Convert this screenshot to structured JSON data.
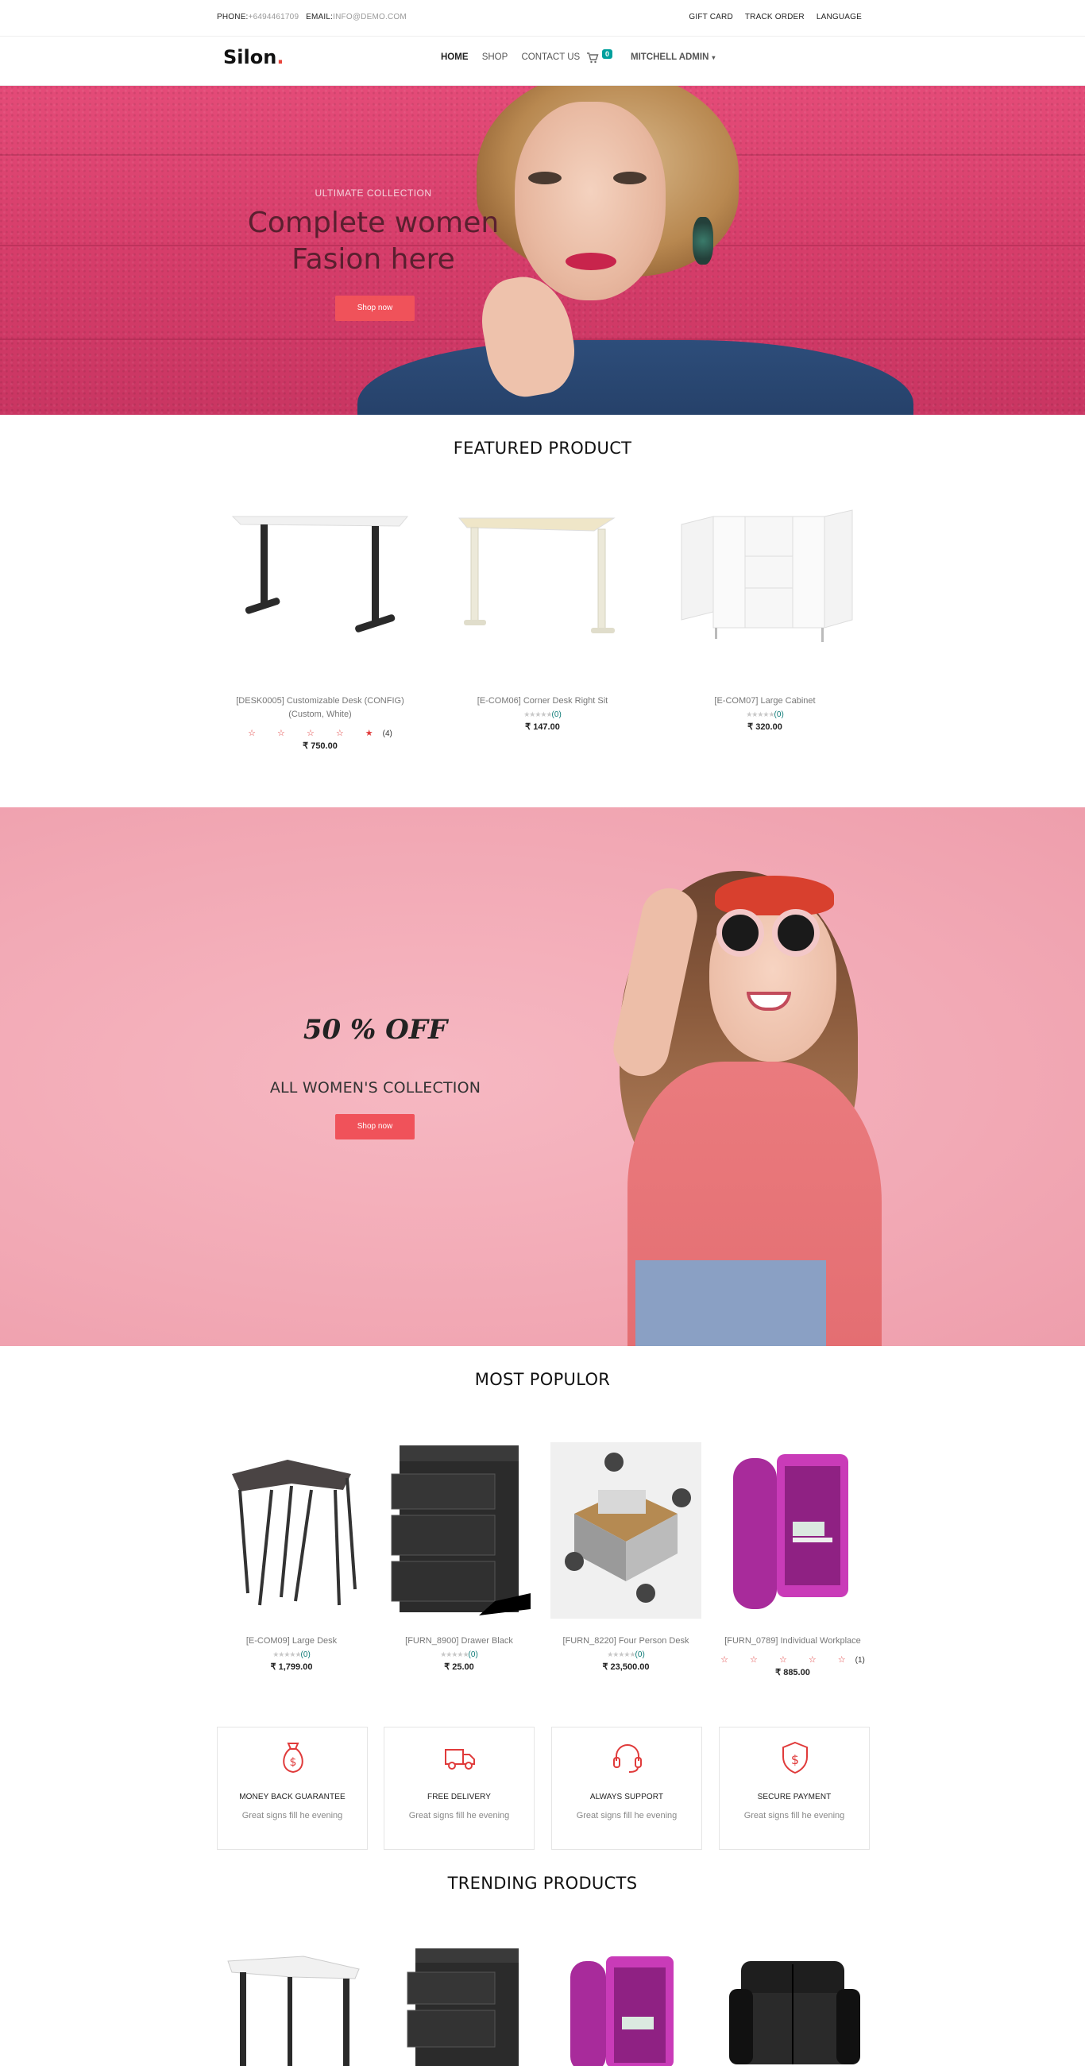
{
  "topbar": {
    "phone_label": "PHONE:",
    "phone_value": "+6494461709",
    "email_label": "EMAIL:",
    "email_value": "INFO@DEMO.COM",
    "links": [
      "GIFT CARD",
      "TRACK ORDER",
      "LANGUAGE"
    ]
  },
  "nav": {
    "logo": "Silon",
    "logo_dot": ".",
    "menu": [
      "HOME",
      "SHOP",
      "CONTACT US"
    ],
    "cart_count": "0",
    "user": "MITCHELL ADMIN",
    "caret": "▾"
  },
  "hero": {
    "subtitle": "ULTIMATE COLLECTION",
    "title": "Complete women Fasion here",
    "button": "Shop now",
    "bg_color": "#d9416e"
  },
  "featured": {
    "title": "FEATURED PRODUCT",
    "products": [
      {
        "name": "[DESK0005] Customizable Desk (CONFIG) (Custom, White)",
        "stars": "☆ ☆ ☆ ☆ ★",
        "rating": "(4)",
        "price": "₹ 750.00",
        "style": "red"
      },
      {
        "name": "[E-COM06] Corner Desk Right Sit",
        "stars": "★★★★★",
        "rating": "(0)",
        "price": "₹ 147.00",
        "style": "grey"
      },
      {
        "name": "[E-COM07] Large Cabinet",
        "stars": "★★★★★",
        "rating": "(0)",
        "price": "₹ 320.00",
        "style": "grey"
      }
    ]
  },
  "promo": {
    "offer": "50 % OFF",
    "collection": "ALL WOMEN'S COLLECTION",
    "button": "Shop now"
  },
  "popular": {
    "title": "MOST POPULOR",
    "products": [
      {
        "name": "[E-COM09] Large Desk",
        "stars": "★★★★★",
        "rating": "(0)",
        "price": "₹ 1,799.00"
      },
      {
        "name": "[FURN_8900] Drawer Black",
        "stars": "★★★★★",
        "rating": "(0)",
        "price": "₹ 25.00"
      },
      {
        "name": "[FURN_8220] Four Person Desk",
        "stars": "★★★★★",
        "rating": "(0)",
        "price": "₹ 23,500.00"
      },
      {
        "name": "[FURN_0789] Individual Workplace",
        "stars": "☆ ☆ ☆ ☆ ☆",
        "rating": "(1)",
        "price": "₹ 885.00"
      }
    ]
  },
  "features": [
    {
      "icon": "money-bag-icon",
      "title": "MONEY BACK GUARANTEE",
      "desc": "Great signs fill he evening"
    },
    {
      "icon": "truck-icon",
      "title": "FREE DELIVERY",
      "desc": "Great signs fill he evening"
    },
    {
      "icon": "headset-icon",
      "title": "ALWAYS SUPPORT",
      "desc": "Great signs fill he evening"
    },
    {
      "icon": "shield-dollar-icon",
      "title": "SECURE PAYMENT",
      "desc": "Great signs fill he evening"
    }
  ],
  "trending": {
    "title": "TRENDING PRODUCTS"
  },
  "colors": {
    "accent": "#f0525a",
    "cart_badge": "#00a09d",
    "star_red": "#e03b3b",
    "rating_teal": "#0d7a76",
    "promo_bg": "#f2a9b5"
  }
}
